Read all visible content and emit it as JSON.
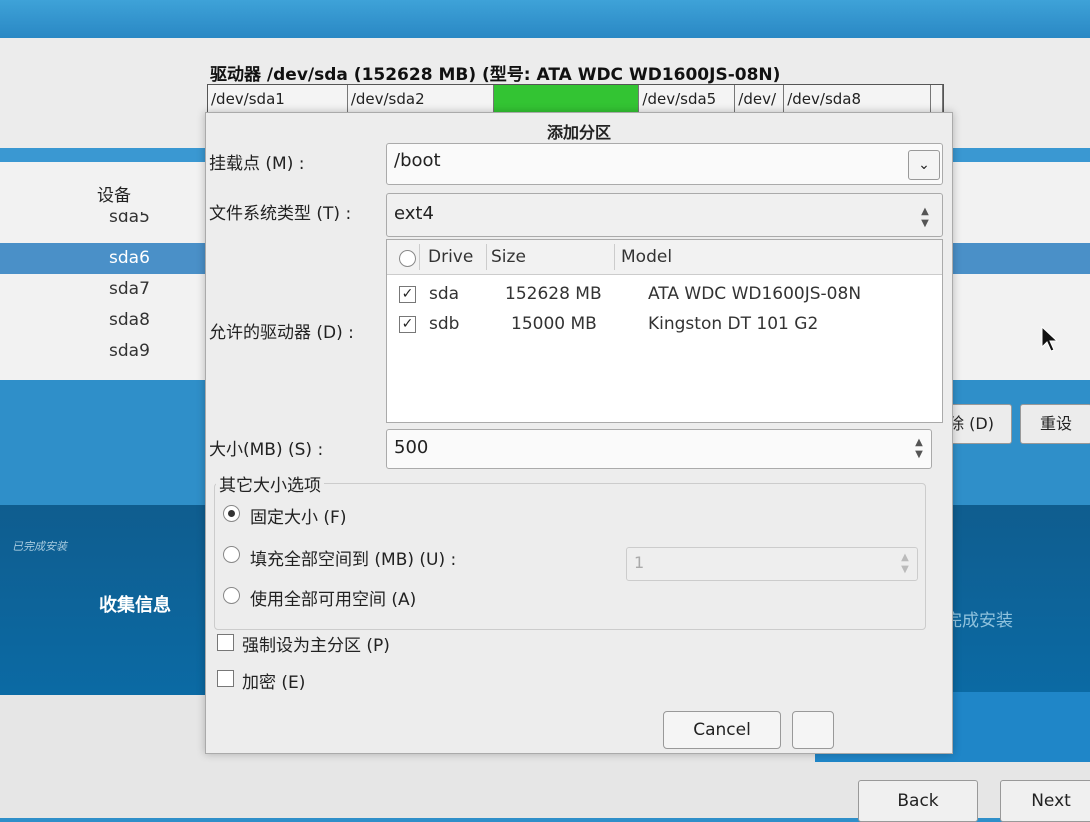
{
  "installer": {
    "drive_title": "驱动器 /dev/sda (152628 MB) (型号: ATA WDC WD1600JS-08N)",
    "partitions": [
      {
        "label": "/dev/sda1",
        "color": "#f4f4f4",
        "share": 0.19
      },
      {
        "label": "/dev/sda2",
        "color": "#f4f4f4",
        "share": 0.198
      },
      {
        "label": "",
        "color": "#33c433",
        "share": 0.198
      },
      {
        "label": "/dev/sda5",
        "color": "#f4f4f4",
        "share": 0.13
      },
      {
        "label": "/dev/",
        "color": "#f4f4f4",
        "share": 0.067
      },
      {
        "label": "/dev/sda8",
        "color": "#f4f4f4",
        "share": 0.2
      },
      {
        "label": "",
        "color": "#f4f4f4",
        "share": 0.017
      }
    ],
    "device_header": "设备",
    "devices": [
      "sda5",
      "sda6",
      "sda7",
      "sda8",
      "sda9"
    ],
    "selected_device": "sda6",
    "delete_button": "除 (D)",
    "reset_button": "重设",
    "done_label": "已完成安装",
    "collect_info": "收集信息",
    "finish_install": "完成安装",
    "back_button": "Back",
    "next_button": "Next"
  },
  "dialog": {
    "title": "添加分区",
    "mount_label": "挂载点 (M) :",
    "mount_value": "/boot",
    "fstype_label": "文件系统类型 (T) :",
    "fstype_value": "ext4",
    "drives_label": "允许的驱动器 (D) :",
    "columns": {
      "drive": "Drive",
      "size": "Size",
      "model": "Model"
    },
    "drives": [
      {
        "drive": "sda",
        "size": "152628 MB",
        "model": "ATA WDC WD1600JS-08N",
        "checked": true
      },
      {
        "drive": "sdb",
        "size": "15000 MB",
        "model": "Kingston DT 101 G2",
        "checked": true
      }
    ],
    "size_label": "大小(MB) (S) :",
    "size_value": "500",
    "other_options_label": "其它大小选项",
    "fixed_size": "固定大小 (F)",
    "fill_to": "填充全部空间到 (MB) (U) :",
    "fill_to_value": "1",
    "fill_all": "使用全部可用空间 (A)",
    "force_primary": "强制设为主分区 (P)",
    "encrypt": "加密 (E)",
    "cancel_button": "Cancel"
  }
}
